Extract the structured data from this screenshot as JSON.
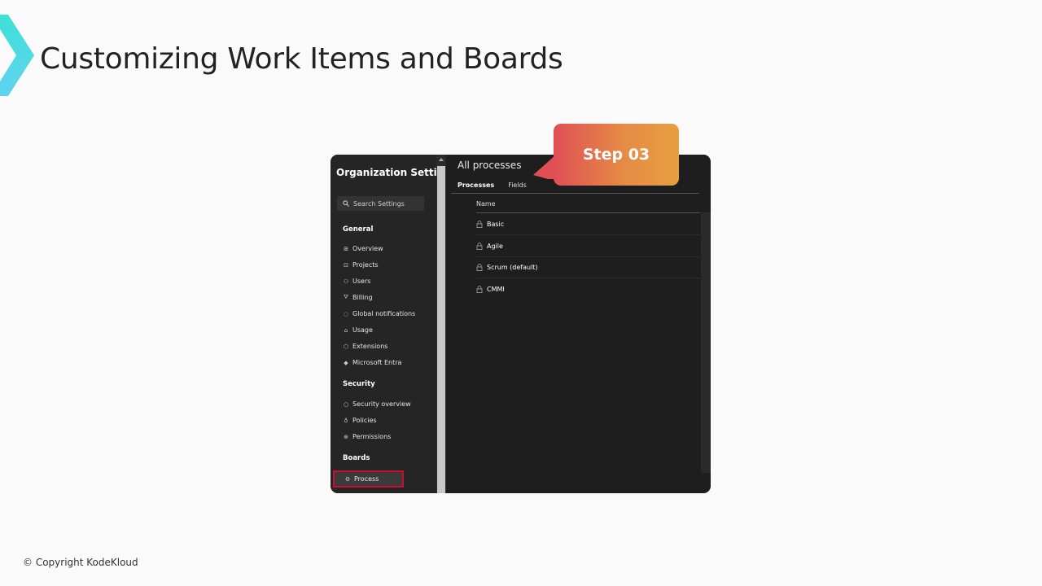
{
  "slide": {
    "title": "Customizing Work Items and Boards",
    "footer": "© Copyright KodeKloud"
  },
  "callout": {
    "label": "Step 03"
  },
  "sidebar": {
    "title": "Organization Setti...",
    "search_placeholder": "Search Settings",
    "groups": [
      {
        "label": "General",
        "items": [
          {
            "label": "Overview",
            "icon": "grid-icon"
          },
          {
            "label": "Projects",
            "icon": "projects-icon"
          },
          {
            "label": "Users",
            "icon": "users-icon"
          },
          {
            "label": "Billing",
            "icon": "cart-icon"
          },
          {
            "label": "Global notifications",
            "icon": "chat-icon"
          },
          {
            "label": "Usage",
            "icon": "usage-icon"
          },
          {
            "label": "Extensions",
            "icon": "extensions-icon"
          },
          {
            "label": "Microsoft Entra",
            "icon": "diamond-icon"
          }
        ]
      },
      {
        "label": "Security",
        "items": [
          {
            "label": "Security overview",
            "icon": "shield-icon"
          },
          {
            "label": "Policies",
            "icon": "lightbulb-icon"
          },
          {
            "label": "Permissions",
            "icon": "lock-icon"
          }
        ]
      },
      {
        "label": "Boards",
        "items": [
          {
            "label": "Process",
            "icon": "process-icon",
            "selected": true
          }
        ]
      }
    ]
  },
  "main": {
    "title": "All processes",
    "tabs": [
      {
        "label": "Processes",
        "active": true
      },
      {
        "label": "Fields",
        "active": false
      }
    ],
    "column_header": "Name",
    "rows": [
      {
        "name": "Basic"
      },
      {
        "name": "Agile"
      },
      {
        "name": "Scrum (default)"
      },
      {
        "name": "CMMI"
      }
    ]
  },
  "colors": {
    "accent_start": "#e04f54",
    "accent_end": "#e6a03f",
    "highlight": "#c8102e",
    "logo": "#3ee0d8"
  }
}
